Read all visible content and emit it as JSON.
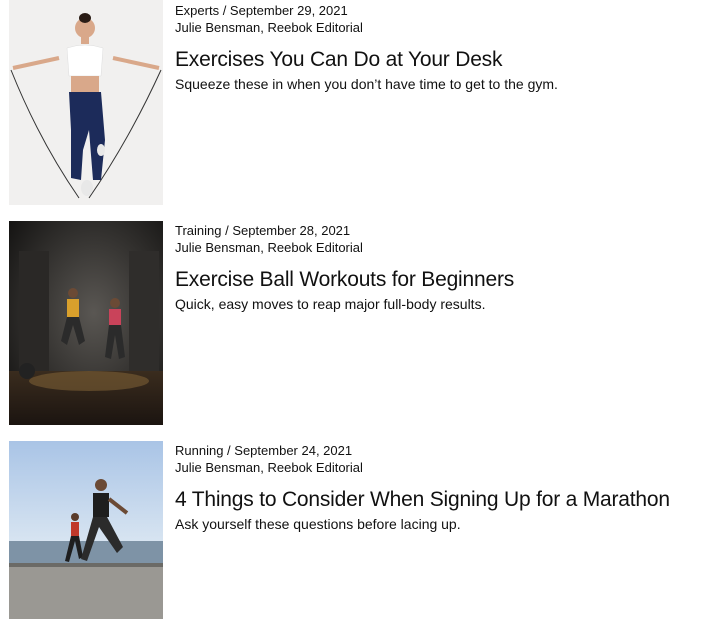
{
  "articles": [
    {
      "category": "Experts",
      "date": "September 29, 2021",
      "author": "Julie Bensman, Reebok Editorial",
      "title": "Exercises You Can Do at Your Desk",
      "description": "Squeeze these in when you don’t have time to get to the gym.",
      "image_icon": "woman-jump-rope-photo"
    },
    {
      "category": "Training",
      "date": "September 28, 2021",
      "author": "Julie Bensman, Reebok Editorial",
      "title": "Exercise Ball Workouts for Beginners",
      "description": "Quick, easy moves to reap major full-body results.",
      "image_icon": "two-people-exercising-photo"
    },
    {
      "category": "Running",
      "date": "September 24, 2021",
      "author": "Julie Bensman, Reebok Editorial",
      "title": "4 Things to Consider When Signing Up for a Marathon",
      "description": "Ask yourself these questions before lacing up.",
      "image_icon": "two-runners-photo"
    }
  ],
  "separator": " / "
}
